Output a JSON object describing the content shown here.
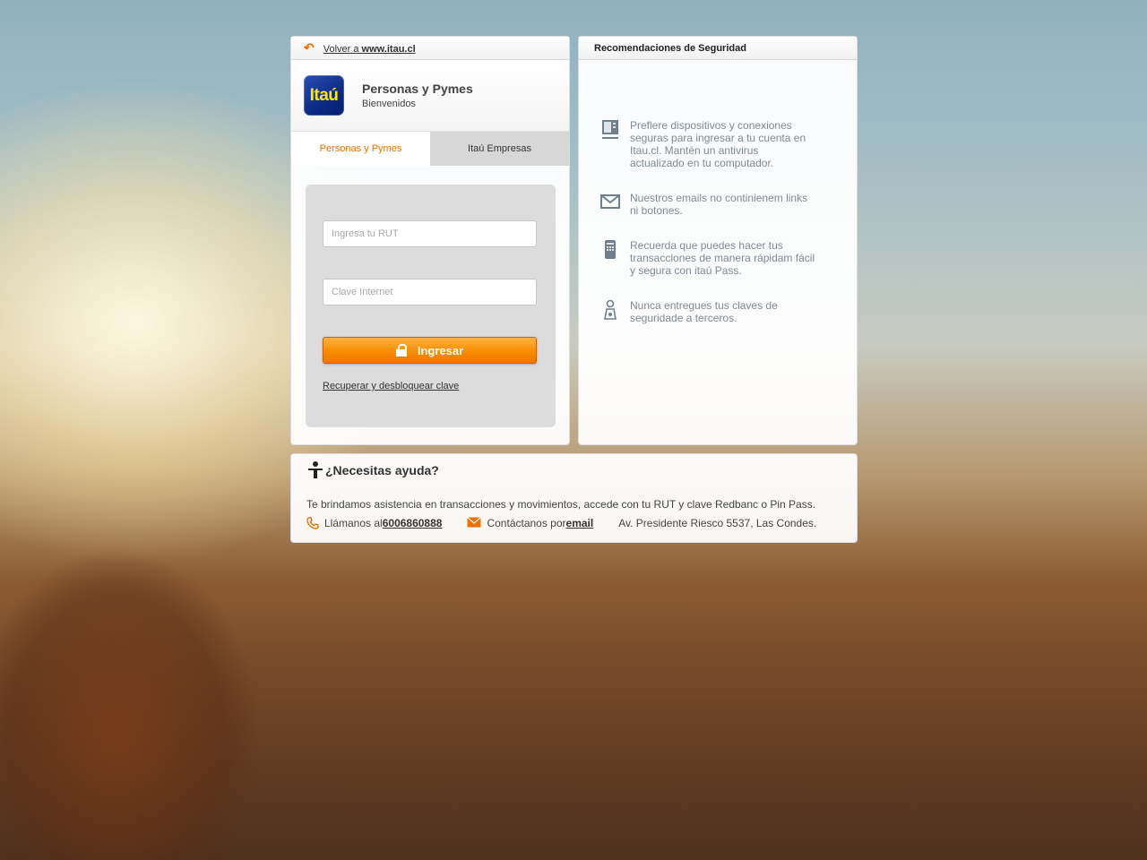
{
  "colors": {
    "accent": "#ec7000",
    "logo_bg": "#0b2a86",
    "logo_text": "#ffe900"
  },
  "header": {
    "back_prefix": "Volver a ",
    "back_site": "www.itau.cl",
    "back_icon": "back-arrow-icon"
  },
  "brand": {
    "logo_text": "Itaú",
    "title": "Personas y Pymes",
    "subtitle": "Bienvenidos"
  },
  "tabs": [
    {
      "label": "Personas y Pymes",
      "active": true
    },
    {
      "label": "Itaú Empresas",
      "active": false
    }
  ],
  "login": {
    "rut_placeholder": "Ingresa tu RUT",
    "rut_value": "",
    "password_placeholder": "Clave Internet",
    "password_value": "",
    "submit_label": "Ingresar",
    "submit_icon": "lock-icon",
    "recover_link": "Recuperar y desbloquear clave"
  },
  "security": {
    "title": "Recomendaciones de Seguridad",
    "items": [
      {
        "icon": "computer-icon",
        "text": "Preflere dispositivos y conexiones seguras para ingresar a tu cuenta en Itau.cl. Mantén un antivirus actualizado en tu computador."
      },
      {
        "icon": "envelope-icon",
        "text": "Nuestros emails no continienem links ni botones."
      },
      {
        "icon": "mobile-phone-icon",
        "text": "Recuerda que puedes hacer tus transacciones de manera rápidam fácil y segura con itaú Pass."
      },
      {
        "icon": "person-key-icon",
        "text": "Nunca entregues tus claves de seguridade a terceros."
      }
    ]
  },
  "help": {
    "title": "¿Necesitas ayuda?",
    "title_icon": "help-person-icon",
    "body": "Te brindamos asistencia en transacciones y movimientos, accede con tu RUT y clave Redbanc o Pin Pass.",
    "call_prefix": "Llámanos al ",
    "phone": "6006860888",
    "email_prefix": "Contáctanos por ",
    "email_link": "email",
    "address": "Av. Presidente Riesco 5537, Las Condes."
  }
}
